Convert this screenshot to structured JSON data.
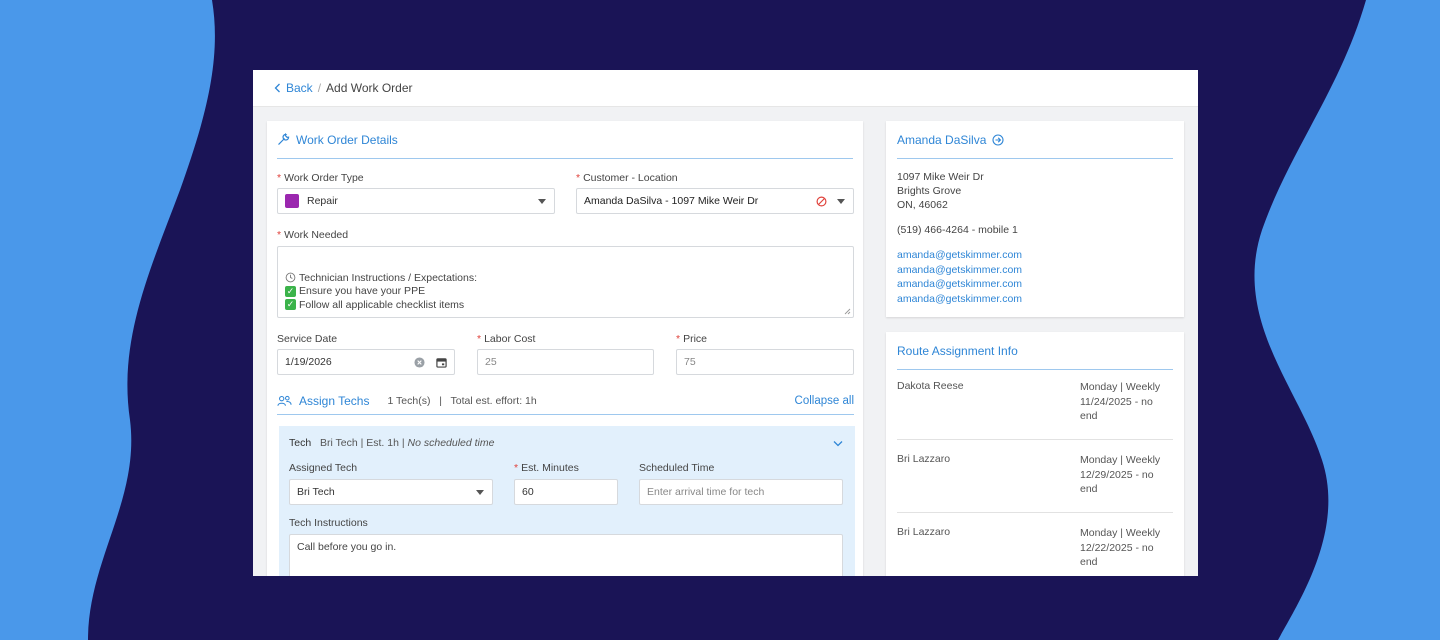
{
  "colors": {
    "background_light": "#4a98ea",
    "background_dark": "#1a1456",
    "accent": "#2f86d6",
    "required": "#e0423c",
    "work_type_swatch": "#9b27af"
  },
  "breadcrumb": {
    "back": "Back",
    "separator": "/",
    "current": "Add Work Order"
  },
  "work_order": {
    "title": "Work Order Details",
    "title_icon": "wrench-icon",
    "type_label": "Work Order Type",
    "type_value": "Repair",
    "location_label": "Customer - Location",
    "location_value": "Amanda DaSilva - 1097 Mike Weir Dr",
    "work_needed_label": "Work Needed",
    "work_needed_lines": [
      "Technician Instructions / Expectations:",
      "Ensure you have your PPE",
      "Follow all applicable checklist items"
    ],
    "service_date_label": "Service Date",
    "service_date_value": "1/19/2026",
    "labor_cost_label": "Labor Cost",
    "labor_cost_value": "25",
    "price_label": "Price",
    "price_value": "75"
  },
  "assign": {
    "title": "Assign Techs",
    "summary": "1 Tech(s)   |   Total est. effort: 1h",
    "collapse": "Collapse all",
    "tech_header_label": "Tech",
    "tech_header_info": "Bri Tech | Est. 1h |",
    "tech_header_time": "No scheduled time",
    "assigned_label": "Assigned Tech",
    "assigned_value": "Bri Tech",
    "minutes_label": "Est. Minutes",
    "minutes_value": "60",
    "scheduled_label": "Scheduled Time",
    "scheduled_placeholder": "Enter arrival time for tech",
    "instructions_label": "Tech Instructions",
    "instructions_value": "Call before you go in."
  },
  "customer": {
    "name": "Amanda DaSilva",
    "address1": "1097 Mike Weir Dr",
    "address2": "Brights Grove",
    "address3": "ON, 46062",
    "phone": "(519) 466-4264 - mobile 1",
    "emails": [
      "amanda@getskimmer.com",
      "amanda@getskimmer.com",
      "amanda@getskimmer.com",
      "amanda@getskimmer.com"
    ]
  },
  "route": {
    "title": "Route Assignment Info",
    "rows": [
      {
        "tech": "Dakota Reese",
        "l1": "Monday | Weekly",
        "l2": "11/24/2025 - no",
        "l3": "end"
      },
      {
        "tech": "Bri Lazzaro",
        "l1": "Monday | Weekly",
        "l2": "12/29/2025 - no",
        "l3": "end"
      },
      {
        "tech": "Bri Lazzaro",
        "l1": "Monday | Weekly",
        "l2": "12/22/2025 - no",
        "l3": "end"
      }
    ]
  }
}
